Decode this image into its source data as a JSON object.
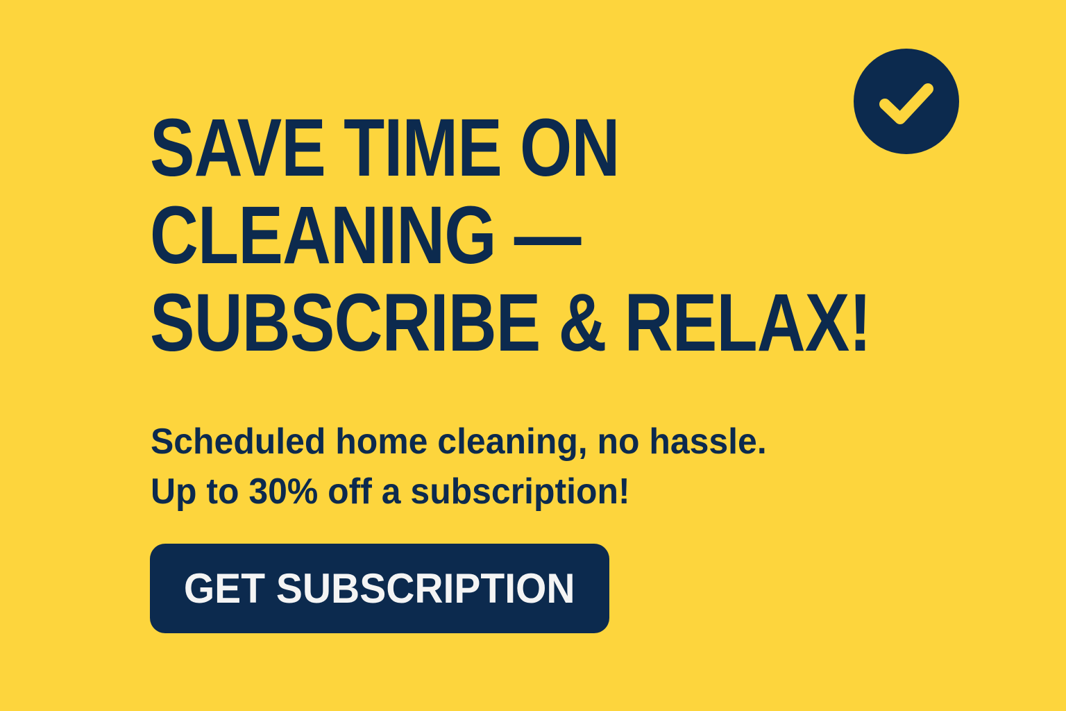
{
  "banner": {
    "headline_lines": [
      "SAVE TIME ON",
      "CLEANING —",
      "SUBSCRIBE & RELAX!"
    ],
    "subtext_lines": [
      "Scheduled home cleaning, no hassle.",
      "Up to 30% off a subscription!"
    ],
    "cta_label": "GET SUBSCRIPTION",
    "badge_icon": "checkmark-icon"
  },
  "colors": {
    "background": "#FDD53D",
    "accent": "#0C2A4E",
    "button_text": "#F4F4F4"
  }
}
